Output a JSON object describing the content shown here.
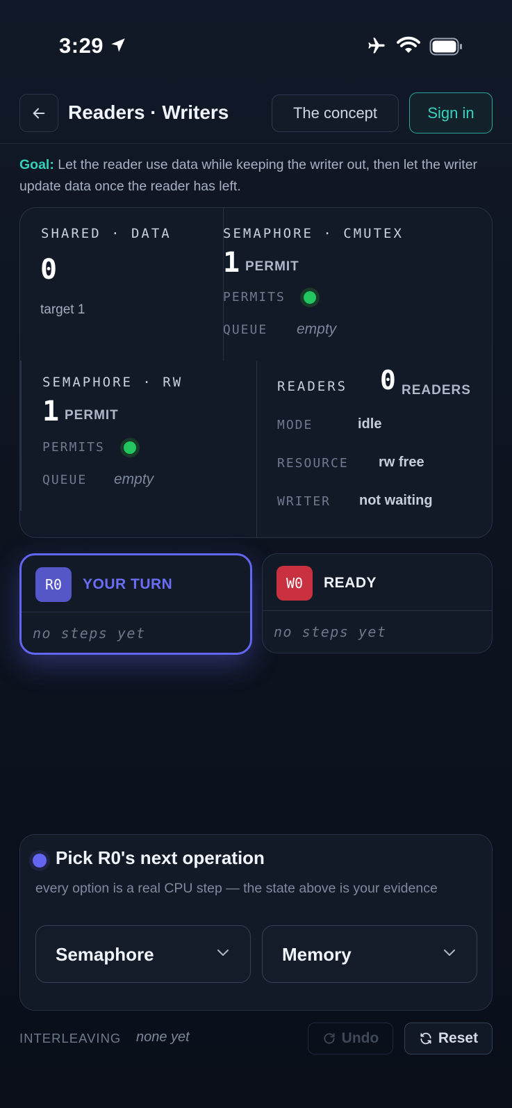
{
  "status_bar": {
    "time": "3:29"
  },
  "header": {
    "title": "Readers · Writers",
    "concept_label": "The concept",
    "signin_label": "Sign in"
  },
  "goal": {
    "label": "Goal:",
    "text": " Let the reader use data while keeping the writer out, then let the writer update data once the reader has left."
  },
  "state": {
    "shared": {
      "label": "SHARED · DATA",
      "value": "0",
      "target": "target 1"
    },
    "cmutex": {
      "label": "SEMAPHORE · CMUTEX",
      "count": "1",
      "unit": "PERMIT",
      "permits_key": "PERMITS",
      "queue_key": "QUEUE",
      "queue_value": "empty"
    },
    "rw": {
      "label": "SEMAPHORE · RW",
      "count": "1",
      "unit": "PERMIT",
      "permits_key": "PERMITS",
      "queue_key": "QUEUE",
      "queue_value": "empty"
    },
    "readers": {
      "label": "READERS",
      "count": "0",
      "unit": "READERS",
      "mode_key": "MODE",
      "mode_value": "idle",
      "resource_key": "RESOURCE",
      "resource_value": "rw free",
      "writer_key": "WRITER",
      "writer_value": "not waiting"
    }
  },
  "threads": [
    {
      "id": "R0",
      "status": "YOUR TURN",
      "steps": "no steps yet",
      "status_color": "#6b6ef5"
    },
    {
      "id": "W0",
      "status": "READY",
      "steps": "no steps yet",
      "status_color": "#eef2f8"
    }
  ],
  "pick": {
    "title": "Pick R0's next operation",
    "subtitle": "every option is a real CPU step — the state above is your evidence",
    "select1": "Semaphore",
    "select2": "Memory"
  },
  "footer": {
    "interleaving_label": "INTERLEAVING",
    "interleaving_value": "none yet",
    "undo_label": "Undo",
    "reset_label": "Reset"
  },
  "colors": {
    "accent": "#6366f1",
    "teal": "#34d1b6",
    "green": "#22c55e",
    "red": "#c93140"
  }
}
